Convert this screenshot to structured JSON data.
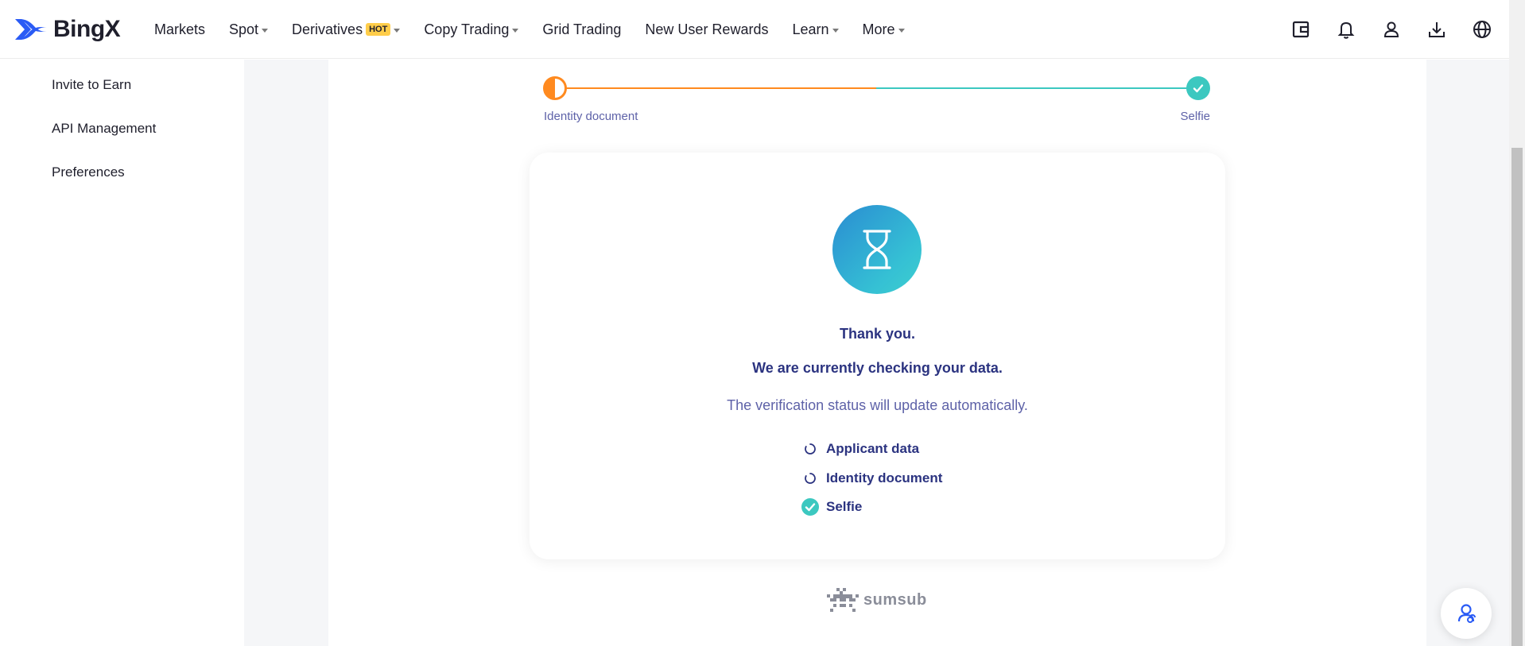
{
  "header": {
    "logo_text": "BingX",
    "nav": [
      {
        "label": "Markets",
        "caret": false
      },
      {
        "label": "Spot",
        "caret": true
      },
      {
        "label": "Derivatives",
        "caret": true,
        "badge": "HOT"
      },
      {
        "label": "Copy Trading",
        "caret": true
      },
      {
        "label": "Grid Trading",
        "caret": false
      },
      {
        "label": "New User Rewards",
        "caret": false
      },
      {
        "label": "Learn",
        "caret": true
      },
      {
        "label": "More",
        "caret": true
      }
    ],
    "icons": [
      "wallet-icon",
      "bell-icon",
      "user-icon",
      "download-icon",
      "globe-icon"
    ]
  },
  "sidebar": {
    "items": [
      "Invite to Earn",
      "API Management",
      "Preferences"
    ]
  },
  "progress": {
    "left_label": "Identity document",
    "right_label": "Selfie"
  },
  "card": {
    "title1": "Thank you.",
    "title2": "We are currently checking your data.",
    "subtitle": "The verification status will update automatically.",
    "statuses": [
      {
        "label": "Applicant data",
        "state": "pending"
      },
      {
        "label": "Identity document",
        "state": "pending"
      },
      {
        "label": "Selfie",
        "state": "done"
      }
    ]
  },
  "footer": {
    "brand": "sumsub"
  },
  "colors": {
    "accent_orange": "#ff8a1f",
    "accent_teal": "#3cc8c0",
    "text_navy": "#2b3380",
    "text_muted": "#5e62a8"
  }
}
